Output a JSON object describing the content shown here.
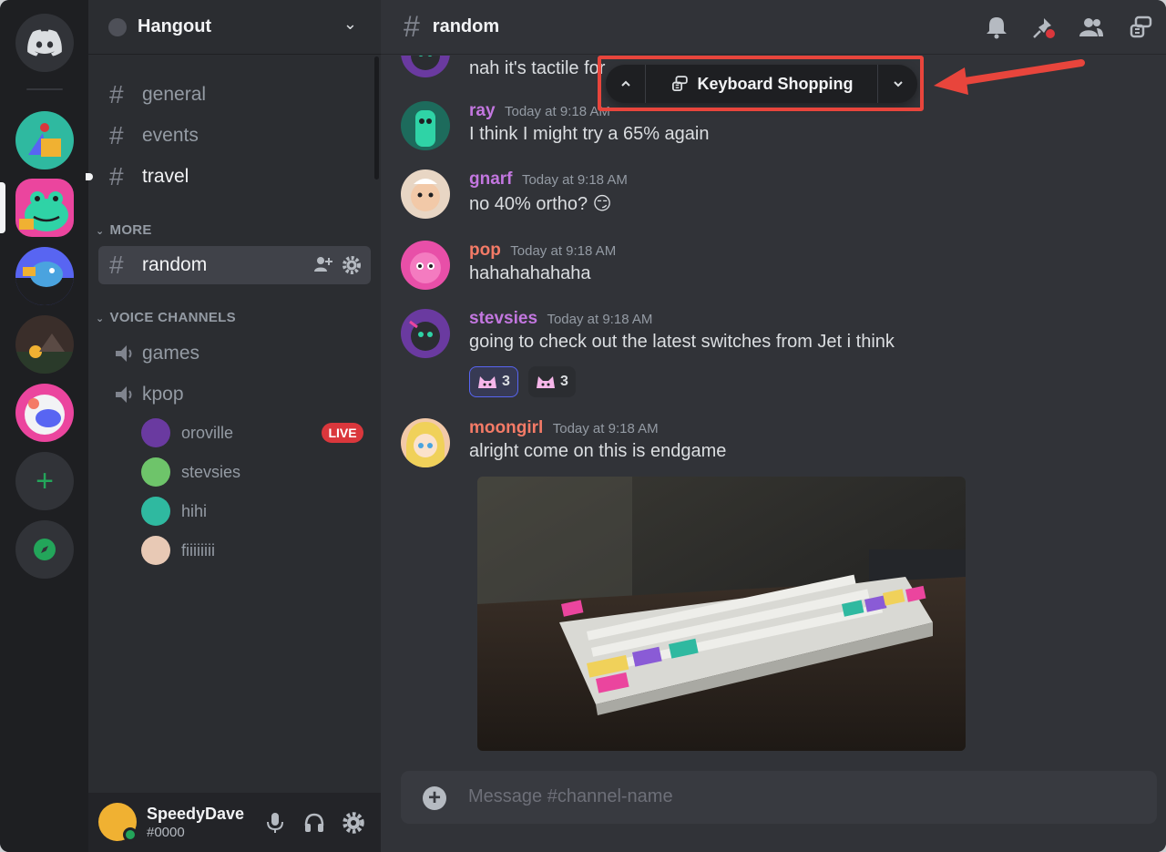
{
  "server": {
    "name": "Hangout"
  },
  "channels": {
    "top": [
      {
        "name": "general",
        "state": "normal"
      },
      {
        "name": "events",
        "state": "normal"
      },
      {
        "name": "travel",
        "state": "unread"
      }
    ],
    "more_category": "MORE",
    "more": [
      {
        "name": "random",
        "state": "active"
      }
    ],
    "voice_category": "VOICE CHANNELS",
    "voice": [
      {
        "name": "games"
      },
      {
        "name": "kpop"
      }
    ],
    "voice_users": [
      {
        "name": "oroville",
        "live": "LIVE"
      },
      {
        "name": "stevsies"
      },
      {
        "name": "hihi"
      },
      {
        "name": "fiiiiiiii"
      }
    ]
  },
  "user": {
    "name": "SpeedyDave",
    "tag": "#0000"
  },
  "header": {
    "channel": "random"
  },
  "thread_popup": {
    "label": "Keyboard Shopping"
  },
  "messages": [
    {
      "author": "",
      "time": "",
      "text": "nah it's tactile for",
      "color": "#dbdee1"
    },
    {
      "author": "ray",
      "time": "Today at 9:18 AM",
      "text": "I think I might try a 65% again",
      "color": "#c377e0"
    },
    {
      "author": "gnarf",
      "time": "Today at 9:18 AM",
      "text": "no 40% ortho? 😏",
      "color": "#c377e0"
    },
    {
      "author": "pop",
      "time": "Today at 9:18 AM",
      "text": "hahahahahaha",
      "color": "#f47b67"
    },
    {
      "author": "stevsies",
      "time": "Today at 9:18 AM",
      "text": "going to check out the latest switches from Jet i think",
      "color": "#c377e0"
    },
    {
      "author": "moongirl",
      "time": "Today at 9:18 AM",
      "text": "alright come on this is endgame",
      "color": "#f47b67"
    }
  ],
  "reactions": [
    {
      "count": "3",
      "mine": true
    },
    {
      "count": "3",
      "mine": false
    }
  ],
  "composer": {
    "placeholder": "Message #channel-name"
  },
  "colors": {
    "accent": "#5865f2",
    "highlight": "#e8453c",
    "live": "#da373c",
    "online": "#23a55a"
  }
}
